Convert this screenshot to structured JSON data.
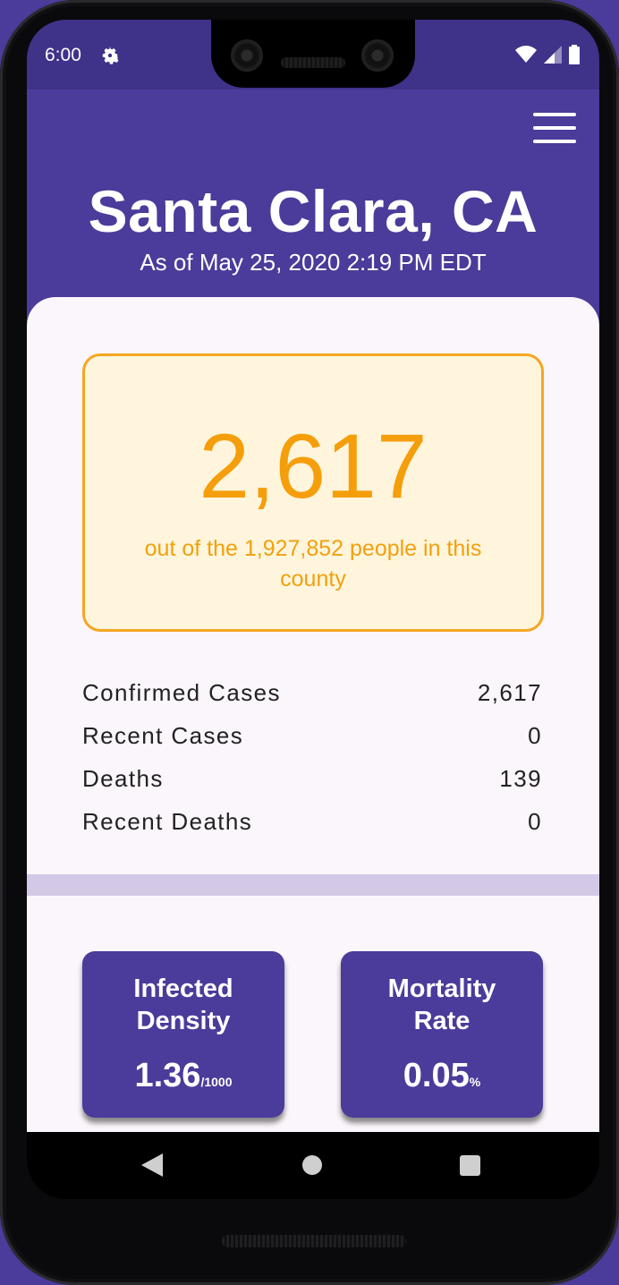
{
  "status_bar": {
    "time": "6:00",
    "icons": [
      "gear-icon",
      "wifi-icon",
      "signal-icon",
      "battery-icon"
    ]
  },
  "header": {
    "title": "Santa Clara, CA",
    "subtitle": "As of May 25, 2020 2:19 PM EDT",
    "menu_icon": "hamburger-menu-icon"
  },
  "highlight": {
    "number": "2,617",
    "caption": "out of the 1,927,852 people in this county"
  },
  "stats": [
    {
      "label": "Confirmed Cases",
      "value": "2,617"
    },
    {
      "label": "Recent Cases",
      "value": "0"
    },
    {
      "label": "Deaths",
      "value": "139"
    },
    {
      "label": "Recent Deaths",
      "value": "0"
    }
  ],
  "metrics": [
    {
      "title_line1": "Infected",
      "title_line2": "Density",
      "value": "1.36",
      "unit": "/1000"
    },
    {
      "title_line1": "Mortality",
      "title_line2": "Rate",
      "value": "0.05",
      "unit": "%"
    }
  ],
  "nav": {
    "icons": [
      "back-icon",
      "home-icon",
      "recent-apps-icon"
    ]
  },
  "colors": {
    "primary": "#4b3b9a",
    "accent": "#f59e0b",
    "highlight_bg": "#fef5dc",
    "divider": "#d3c9e6"
  }
}
